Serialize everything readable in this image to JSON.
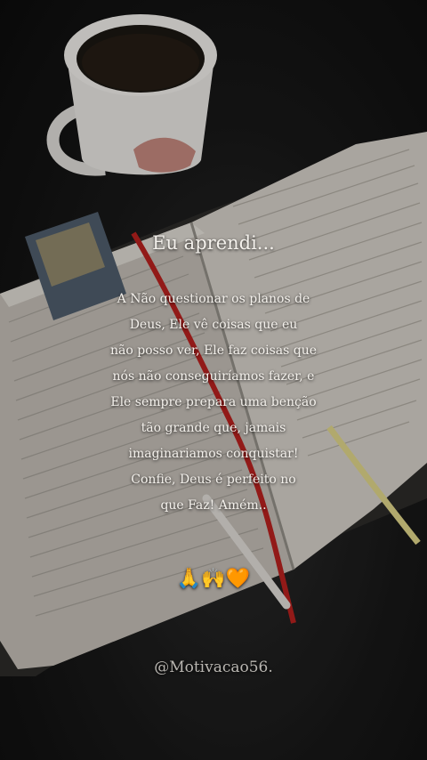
{
  "post": {
    "intro": "Eu aprendi...",
    "lines": [
      "A Não questionar os planos de",
      "Deus, Ele vê coisas que eu",
      "não posso ver, Ele faz coisas que",
      "nós não conseguiríamos fazer, e",
      "Ele sempre prepara uma benção",
      "tão grande que, jamais",
      "imaginariamos conquistar!",
      "Confie, Deus é perfeito no",
      "que Faz! Amém.."
    ],
    "emojis": "🙏🙌🧡",
    "handle": "@Motivacao56."
  },
  "photo": {
    "subject": "coffee-mug-and-open-bible",
    "colors": {
      "background": "#141414",
      "page": "#cfcac2",
      "bookmark_red": "#b3201e",
      "ribbon_yellow": "#d8cf86",
      "text": "#f4f1ec"
    }
  }
}
